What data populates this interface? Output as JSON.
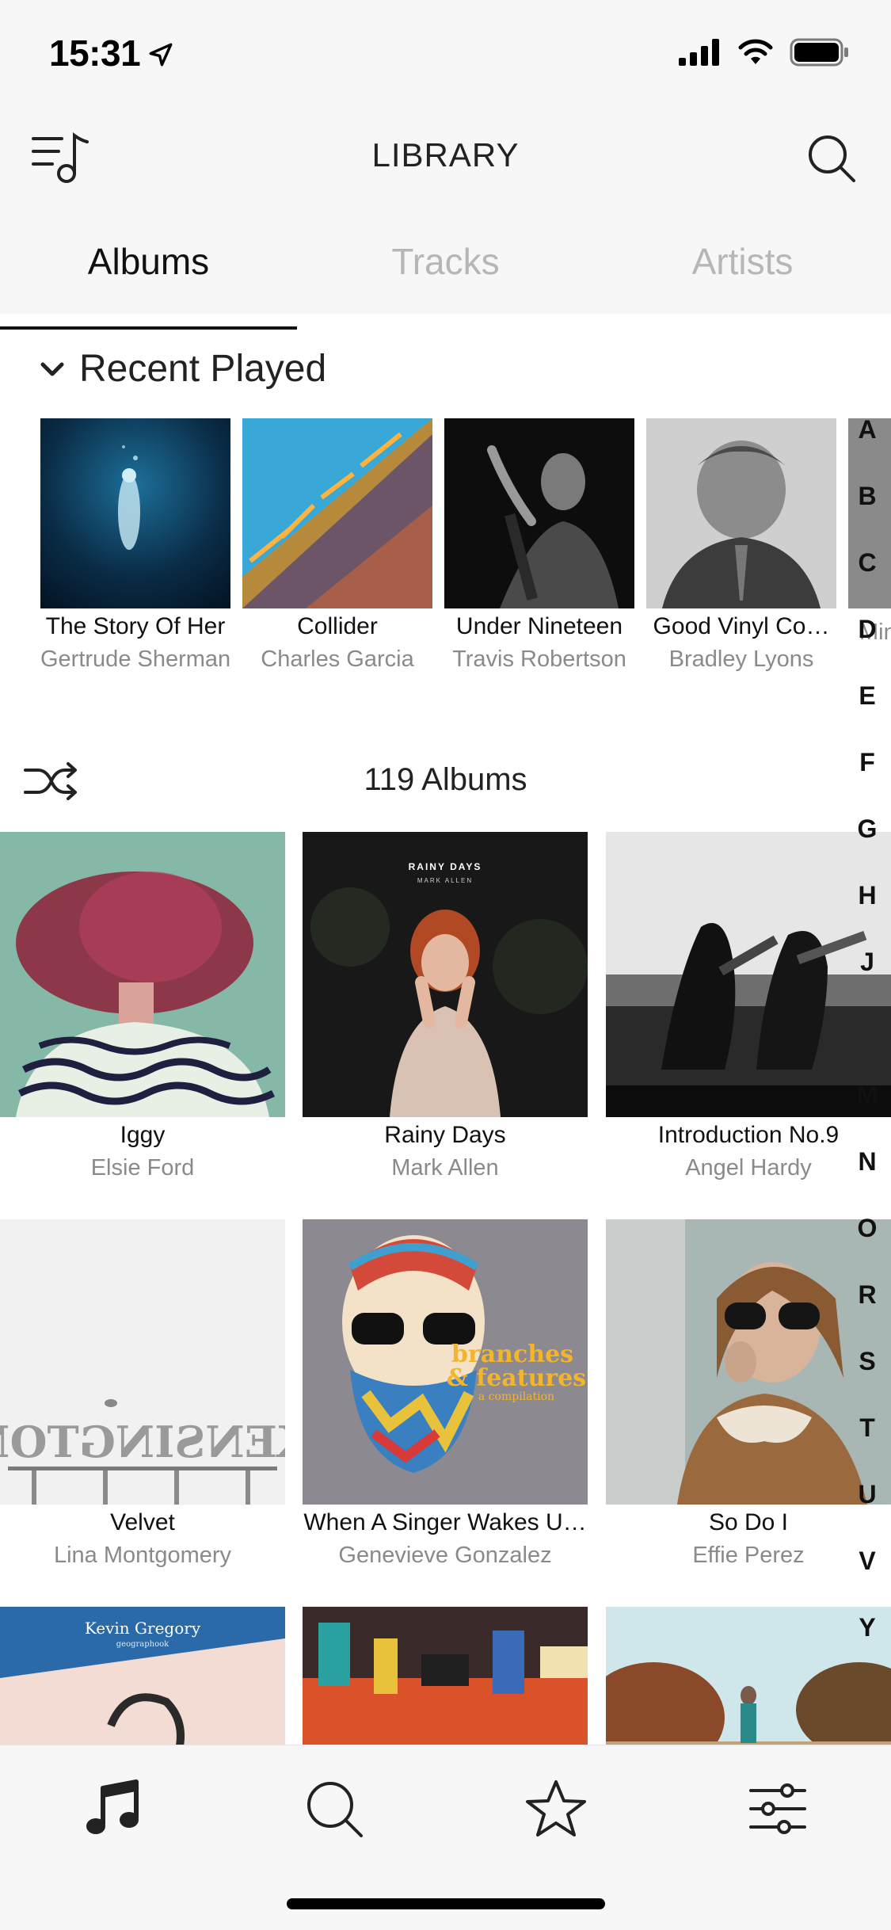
{
  "status": {
    "time": "15:31",
    "icons": [
      "location-arrow-icon",
      "signal-icon",
      "wifi-icon",
      "battery-icon"
    ]
  },
  "header": {
    "title": "LIBRARY",
    "left_icon": "playlist-music-icon",
    "right_icon": "search-icon"
  },
  "tabs": [
    {
      "label": "Albums",
      "active": true
    },
    {
      "label": "Tracks",
      "active": false
    },
    {
      "label": "Artists",
      "active": false
    }
  ],
  "recent": {
    "title": "Recent Played",
    "items": [
      {
        "title": "The Story Of Her",
        "artist": "Gertrude Sherman"
      },
      {
        "title": "Collider",
        "artist": "Charles Garcia"
      },
      {
        "title": "Under Nineteen",
        "artist": "Travis Robertson"
      },
      {
        "title": "Good Vinyl Co…",
        "artist": "Bradley Lyons"
      },
      {
        "title": "",
        "artist": "Min"
      }
    ]
  },
  "albums": {
    "count_label": "119 Albums",
    "items": [
      {
        "title": "Iggy",
        "artist": "Elsie Ford"
      },
      {
        "title": "Rainy Days",
        "artist": "Mark Allen",
        "cover_text": [
          "RAINY DAYS",
          "MARK ALLEN"
        ]
      },
      {
        "title": "Introduction No.9",
        "artist": "Angel Hardy"
      },
      {
        "title": "Velvet",
        "artist": "Lina Montgomery",
        "cover_text": [
          "KENSINGTON"
        ]
      },
      {
        "title": "When A Singer Wakes U…",
        "artist": "Genevieve Gonzalez",
        "cover_text": [
          "branches",
          "& features",
          "a compilation"
        ]
      },
      {
        "title": "So Do I",
        "artist": "Effie Perez"
      },
      {
        "title": "",
        "artist": "",
        "cover_text": [
          "Kevin Gregory",
          "geographook"
        ]
      },
      {
        "title": "",
        "artist": ""
      },
      {
        "title": "",
        "artist": ""
      }
    ]
  },
  "alphabet": [
    "A",
    "B",
    "C",
    "D",
    "E",
    "F",
    "G",
    "H",
    "J",
    "M",
    "N",
    "O",
    "R",
    "S",
    "T",
    "U",
    "V",
    "Y"
  ],
  "tabbar": {
    "items": [
      "music-note-icon",
      "search-icon",
      "star-icon",
      "sliders-icon"
    ]
  }
}
